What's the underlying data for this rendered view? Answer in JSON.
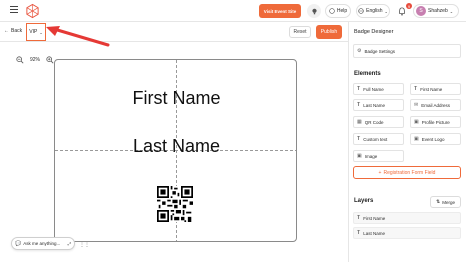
{
  "topbar": {
    "visit_label": "Visit Event Site",
    "help_label": "Help",
    "language_label": "English",
    "notification_count": "9",
    "user_name": "Shahzeb",
    "user_initial": "S"
  },
  "subbar": {
    "back_label": "Back",
    "badge_type": "VIP",
    "reset_label": "Reset",
    "publish_label": "Publish"
  },
  "canvas": {
    "zoom_level": "92%",
    "first_name": "First Name",
    "last_name": "Last Name",
    "assistant_label": "Ask me anything..."
  },
  "panel": {
    "title": "Badge Designer",
    "settings_label": "Badge Settings",
    "elements_title": "Elements",
    "elements": [
      {
        "label": "Full Name",
        "icon": "text-icon"
      },
      {
        "label": "First Name",
        "icon": "text-icon"
      },
      {
        "label": "Last Name",
        "icon": "text-icon"
      },
      {
        "label": "Email Address",
        "icon": "mail-icon"
      },
      {
        "label": "QR Code",
        "icon": "qr-icon"
      },
      {
        "label": "Profile Picture",
        "icon": "image-icon"
      },
      {
        "label": "Custom text",
        "icon": "text-icon"
      },
      {
        "label": "Event Logo",
        "icon": "image-icon"
      },
      {
        "label": "Image",
        "icon": "image-icon"
      }
    ],
    "registration_label": "Registration Form Field",
    "layers_title": "Layers",
    "merge_label": "Merge",
    "layers": [
      {
        "label": "First Name"
      },
      {
        "label": "Last Name"
      }
    ]
  },
  "colors": {
    "accent": "#ef6a3a",
    "border": "#e6e6e6"
  }
}
